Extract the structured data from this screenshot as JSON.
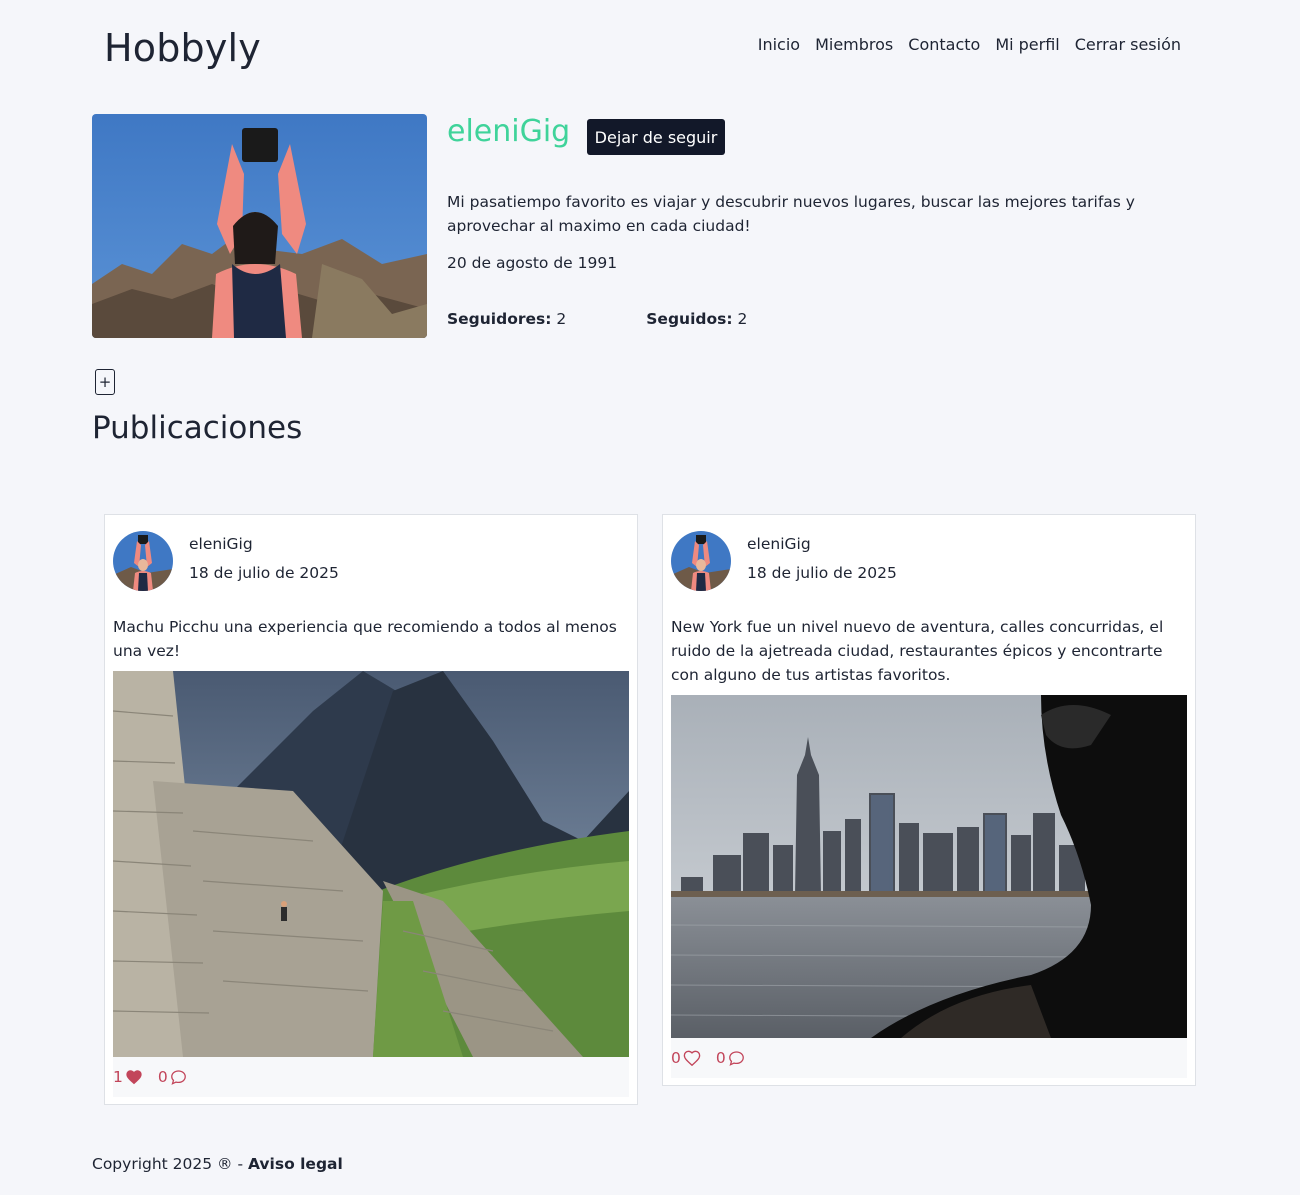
{
  "header": {
    "logo": "Hobbyly",
    "nav": [
      "Inicio",
      "Miembros",
      "Contacto",
      "Mi perfil",
      "Cerrar sesión"
    ]
  },
  "profile": {
    "username": "eleniGig",
    "follow_button": "Dejar de seguir",
    "bio": "Mi pasatiempo favorito es viajar y descubrir nuevos lugares, buscar las mejores tarifas y aprovechar al maximo en cada ciudad!",
    "birthdate": "20 de agosto de 1991",
    "followers_label": "Seguidores:",
    "followers_count": "2",
    "following_label": "Seguidos:",
    "following_count": "2"
  },
  "posts_section": {
    "add_icon": "plus-square-icon",
    "title": "Publicaciones"
  },
  "posts": [
    {
      "author": "eleniGig",
      "date": "18 de julio de 2025",
      "text": "Machu Picchu una experiencia que recomiendo a todos al menos una vez!",
      "likes": "1",
      "liked": true,
      "comments": "0"
    },
    {
      "author": "eleniGig",
      "date": "18 de julio de 2025",
      "text": "New York fue un nivel nuevo de aventura, calles concurridas, el ruido de la ajetreada ciudad, restaurantes épicos y encontrarte con alguno de tus artistas favoritos.",
      "likes": "0",
      "liked": false,
      "comments": "0"
    }
  ],
  "footer": {
    "copyright": "Copyright 2025 ® - ",
    "legal_link": "Aviso legal"
  },
  "colors": {
    "accent": "#3fd39a",
    "button_dark": "#121829",
    "reaction": "#c2455a",
    "background": "#f5f6fa"
  }
}
